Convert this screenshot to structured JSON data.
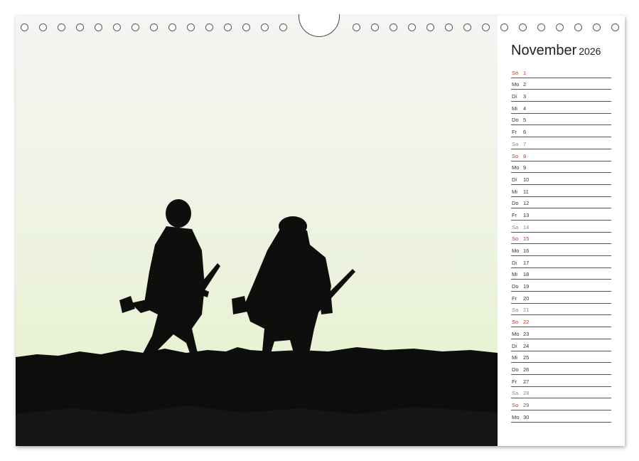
{
  "calendar": {
    "month": "November",
    "year": "2026",
    "days": [
      {
        "dow": "So",
        "day": "1",
        "type": "sun"
      },
      {
        "dow": "Mo",
        "day": "2",
        "type": "week"
      },
      {
        "dow": "Di",
        "day": "3",
        "type": "week"
      },
      {
        "dow": "Mi",
        "day": "4",
        "type": "week"
      },
      {
        "dow": "Do",
        "day": "5",
        "type": "week"
      },
      {
        "dow": "Fr",
        "day": "6",
        "type": "week"
      },
      {
        "dow": "Sa",
        "day": "7",
        "type": "sat"
      },
      {
        "dow": "So",
        "day": "8",
        "type": "sun"
      },
      {
        "dow": "Mo",
        "day": "9",
        "type": "week"
      },
      {
        "dow": "Di",
        "day": "10",
        "type": "week"
      },
      {
        "dow": "Mi",
        "day": "11",
        "type": "week"
      },
      {
        "dow": "Do",
        "day": "12",
        "type": "week"
      },
      {
        "dow": "Fr",
        "day": "13",
        "type": "week"
      },
      {
        "dow": "Sa",
        "day": "14",
        "type": "sat"
      },
      {
        "dow": "So",
        "day": "15",
        "type": "sun"
      },
      {
        "dow": "Mo",
        "day": "16",
        "type": "week"
      },
      {
        "dow": "Di",
        "day": "17",
        "type": "week"
      },
      {
        "dow": "Mi",
        "day": "18",
        "type": "week"
      },
      {
        "dow": "Do",
        "day": "19",
        "type": "week"
      },
      {
        "dow": "Fr",
        "day": "20",
        "type": "week"
      },
      {
        "dow": "Sa",
        "day": "21",
        "type": "sat"
      },
      {
        "dow": "So",
        "day": "22",
        "type": "sun"
      },
      {
        "dow": "Mo",
        "day": "23",
        "type": "week"
      },
      {
        "dow": "Di",
        "day": "24",
        "type": "week"
      },
      {
        "dow": "Mi",
        "day": "25",
        "type": "week"
      },
      {
        "dow": "Do",
        "day": "26",
        "type": "week"
      },
      {
        "dow": "Fr",
        "day": "27",
        "type": "week"
      },
      {
        "dow": "Sa",
        "day": "28",
        "type": "sat"
      },
      {
        "dow": "So",
        "day": "29",
        "type": "sun"
      },
      {
        "dow": "Mo",
        "day": "30",
        "type": "week"
      }
    ]
  },
  "colors": {
    "sunday": "#c0392b",
    "saturday": "#8a8a8a",
    "weekday": "#333333",
    "sky_top": "#f4f4f2",
    "sky_bottom": "#e8f2cf",
    "silhouette": "#0e0f0c"
  },
  "photo": {
    "subject": "two hunters silhouette"
  }
}
